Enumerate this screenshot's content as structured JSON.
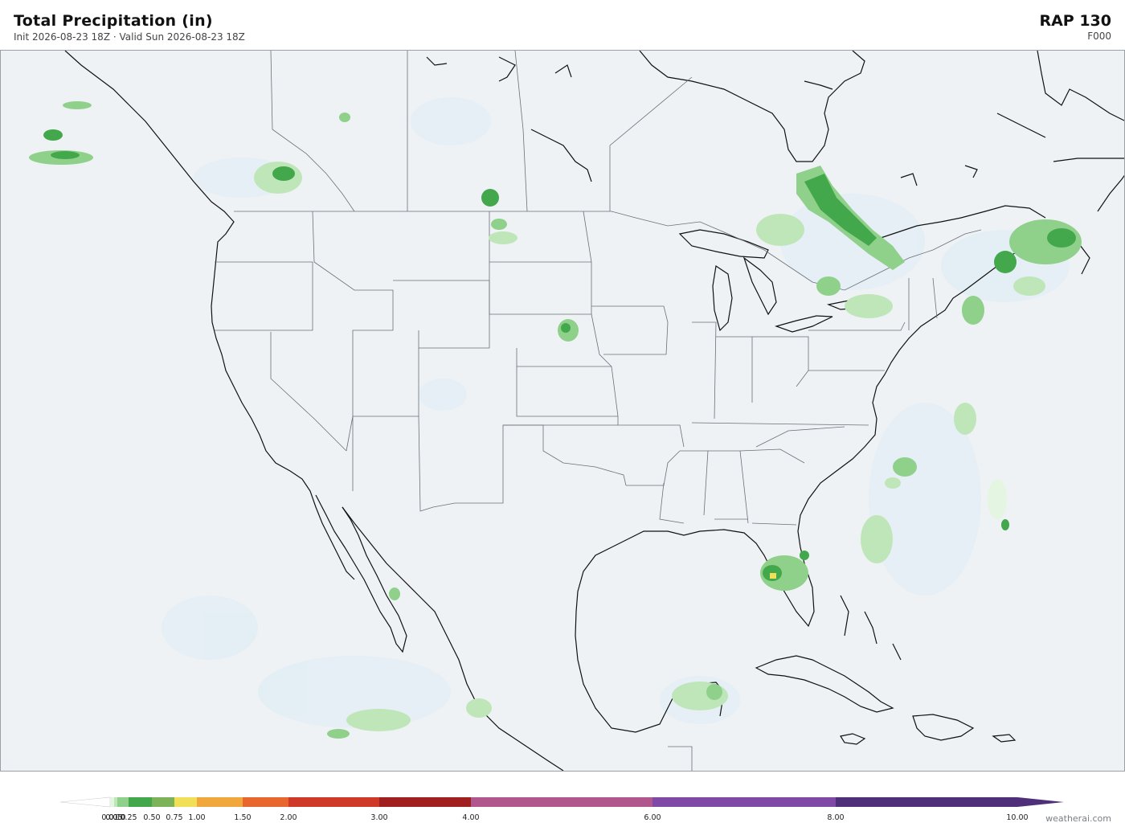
{
  "header": {
    "title": "Total Precipitation  (in)",
    "subtitle": "Init 2026-08-23 18Z   ·   Valid Sun 2026-08-23 18Z",
    "model": "RAP  130",
    "forecast_hour": "F000"
  },
  "map": {
    "region": "North America (CONUS)",
    "background_color": "#eef2f5",
    "land_color": "#eef2f5",
    "border_color": "#6b7078",
    "coast_color": "#111111"
  },
  "legend": {
    "ticks": [
      {
        "label": "0.01",
        "value": 0.01
      },
      {
        "label": "0.05",
        "value": 0.05
      },
      {
        "label": "0.10",
        "value": 0.1
      },
      {
        "label": "0.25",
        "value": 0.25
      },
      {
        "label": "0.50",
        "value": 0.5
      },
      {
        "label": "0.75",
        "value": 0.75
      },
      {
        "label": "1.00",
        "value": 1.0
      },
      {
        "label": "1.50",
        "value": 1.5
      },
      {
        "label": "2.00",
        "value": 2.0
      },
      {
        "label": "3.00",
        "value": 3.0
      },
      {
        "label": "4.00",
        "value": 4.0
      },
      {
        "label": "6.00",
        "value": 6.0
      },
      {
        "label": "8.00",
        "value": 8.0
      },
      {
        "label": "10.00",
        "value": 10.0
      }
    ],
    "bins": [
      {
        "from": 0.01,
        "to": 0.05,
        "color": "#e4f5e1"
      },
      {
        "from": 0.05,
        "to": 0.1,
        "color": "#bfe6b8"
      },
      {
        "from": 0.1,
        "to": 0.25,
        "color": "#8fd08a"
      },
      {
        "from": 0.25,
        "to": 0.5,
        "color": "#43a84c"
      },
      {
        "from": 0.5,
        "to": 0.75,
        "color": "#7db358"
      },
      {
        "from": 0.75,
        "to": 1.0,
        "color": "#f2df58"
      },
      {
        "from": 1.0,
        "to": 1.5,
        "color": "#f0a73c"
      },
      {
        "from": 1.5,
        "to": 2.0,
        "color": "#e8672e"
      },
      {
        "from": 2.0,
        "to": 3.0,
        "color": "#cf3a28"
      },
      {
        "from": 3.0,
        "to": 4.0,
        "color": "#a01f1f"
      },
      {
        "from": 4.0,
        "to": 6.0,
        "color": "#b0588e"
      },
      {
        "from": 6.0,
        "to": 8.0,
        "color": "#8049a6"
      },
      {
        "from": 8.0,
        "to": 10.0,
        "color": "#4f2f7a"
      }
    ],
    "under_color": "#ffffff",
    "over_color": "#4f2f7a"
  },
  "precip_areas": [
    {
      "region": "Gulf of Alaska",
      "level": 0.25
    },
    {
      "region": "British Columbia interior",
      "level": 0.25
    },
    {
      "region": "Saskatchewan",
      "level": 0.5
    },
    {
      "region": "North Dakota",
      "level": 0.25
    },
    {
      "region": "Nebraska",
      "level": 0.25
    },
    {
      "region": "Northern Quebec / Ontario",
      "level": 0.5
    },
    {
      "region": "Maritimes",
      "level": 0.5
    },
    {
      "region": "Western Atlantic",
      "level": 0.25
    },
    {
      "region": "Florida",
      "level": 1.0
    },
    {
      "region": "Yucatan",
      "level": 0.25
    },
    {
      "region": "Western Mexico",
      "level": 0.5
    }
  ],
  "credit": "weatherai.com"
}
